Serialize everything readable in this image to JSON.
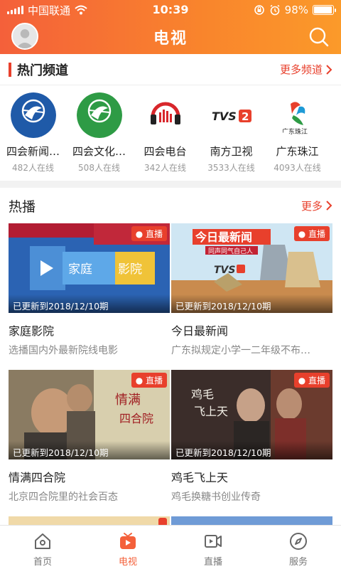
{
  "status_bar": {
    "carrier": "中国联通",
    "time": "10:39",
    "battery": "98%",
    "battery_level": 0.98
  },
  "nav": {
    "title": "电视"
  },
  "hot_channels": {
    "title": "热门频道",
    "more": "更多频道",
    "items": [
      {
        "name": "四会新闻…",
        "online": "482人在线",
        "logo_text": "SHRTV"
      },
      {
        "name": "四会文化…",
        "online": "508人在线",
        "logo_text": "SHRTV"
      },
      {
        "name": "四会电台",
        "online": "342人在线",
        "logo_text": "FM100.9 四会电台"
      },
      {
        "name": "南方卫视",
        "online": "3533人在线",
        "logo_text": "TVS2"
      },
      {
        "name": "广东珠江",
        "online": "4093人在线",
        "logo_text": "广东珠江"
      }
    ]
  },
  "hot": {
    "title": "热播",
    "more": "更多",
    "cards": [
      {
        "title": "家庭影院",
        "desc": "选播国内外最新院线电影",
        "badge": "直播",
        "updated": "已更新到2018/12/10期",
        "thumb_text": "家庭影院"
      },
      {
        "title": "今日最新闻",
        "desc": "广东拟规定小学一二年级不布…",
        "badge": "直播",
        "updated": "已更新到2018/12/10期",
        "thumb_text": "今日最新闻",
        "thumb_sub": "同声同气自己人"
      },
      {
        "title": "情满四合院",
        "desc": "北京四合院里的社会百态",
        "badge": "直播",
        "updated": "已更新到2018/12/10期",
        "thumb_text": "情满四合院"
      },
      {
        "title": "鸡毛飞上天",
        "desc": "鸡毛换糖书创业传奇",
        "badge": "直播",
        "updated": "已更新到2018/12/10期",
        "thumb_text": "鸡毛飞上天"
      }
    ]
  },
  "tabbar": {
    "items": [
      {
        "label": "首页",
        "icon": "home-icon"
      },
      {
        "label": "电视",
        "icon": "tv-icon"
      },
      {
        "label": "直播",
        "icon": "live-camera-icon"
      },
      {
        "label": "服务",
        "icon": "compass-icon"
      }
    ],
    "active_index": 1
  },
  "colors": {
    "accent": "#e8402c",
    "header_start": "#f4603a",
    "header_end": "#fb9a2a"
  }
}
